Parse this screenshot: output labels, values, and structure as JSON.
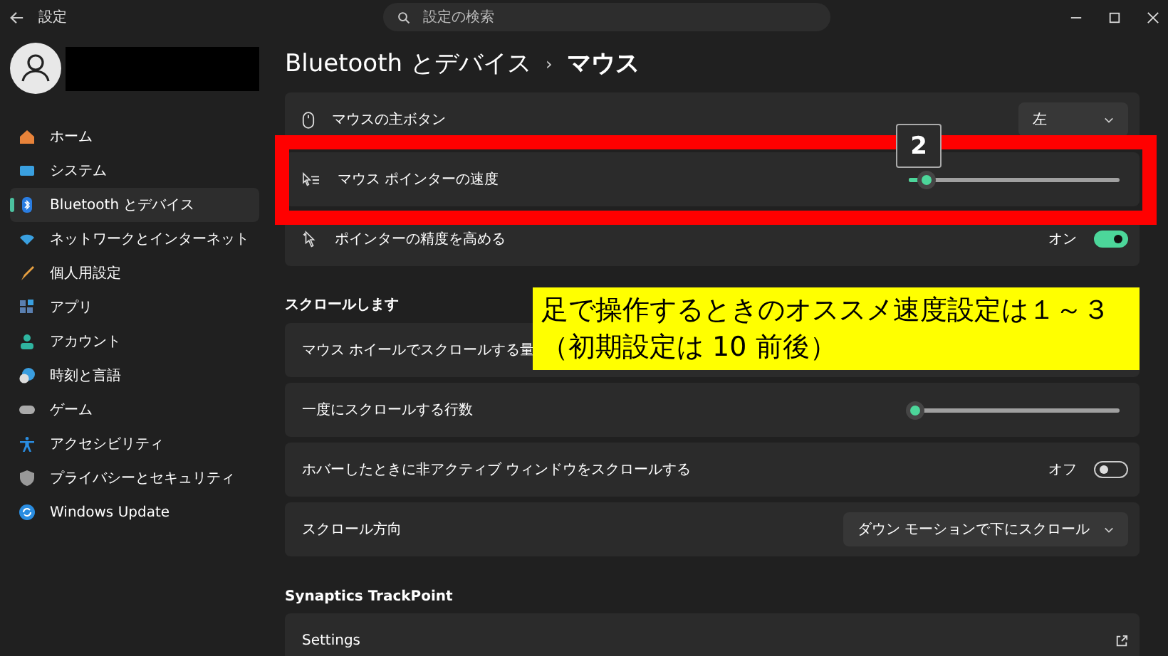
{
  "window": {
    "title": "設定",
    "search_placeholder": "設定の検索"
  },
  "sidebar": {
    "items": [
      {
        "label": "ホーム",
        "selected": false
      },
      {
        "label": "システム",
        "selected": false
      },
      {
        "label": "Bluetooth とデバイス",
        "selected": true
      },
      {
        "label": "ネットワークとインターネット",
        "selected": false
      },
      {
        "label": "個人用設定",
        "selected": false
      },
      {
        "label": "アプリ",
        "selected": false
      },
      {
        "label": "アカウント",
        "selected": false
      },
      {
        "label": "時刻と言語",
        "selected": false
      },
      {
        "label": "ゲーム",
        "selected": false
      },
      {
        "label": "アクセシビリティ",
        "selected": false
      },
      {
        "label": "プライバシーとセキュリティ",
        "selected": false
      },
      {
        "label": "Windows Update",
        "selected": false
      }
    ]
  },
  "breadcrumb": {
    "parent": "Bluetooth とデバイス",
    "separator": "›",
    "current": "マウス"
  },
  "mouse_rows": [
    {
      "kind": "dropdown",
      "label": "マウスの主ボタン",
      "value": "左"
    },
    {
      "kind": "slider",
      "label": "マウス ポインターの速度",
      "level": 0.08
    },
    {
      "kind": "toggle",
      "label": "ポインターの精度を高める",
      "on": true,
      "state_label": "オン"
    }
  ],
  "scroll": {
    "heading": "スクロールします",
    "rows": [
      {
        "kind": "plain",
        "label": "マウス ホイールでスクロールする量"
      },
      {
        "kind": "slider",
        "label": "一度にスクロールする行数",
        "level": 0.03
      },
      {
        "kind": "toggle",
        "label": "ホバーしたときに非アクティブ ウィンドウをスクロールする",
        "on": false,
        "state_label": "オフ"
      },
      {
        "kind": "dropdown",
        "label": "スクロール方向",
        "value": "ダウン モーションで下にスクロール"
      }
    ]
  },
  "trackpoint": {
    "heading": "Synaptics TrackPoint",
    "rows": [
      {
        "kind": "link",
        "label": "Settings"
      }
    ]
  },
  "annotation": {
    "marker": "2",
    "callout_lines": [
      "足で操作するときのオススメ速度設定は１～３",
      "（初期設定は 10 前後）"
    ]
  }
}
